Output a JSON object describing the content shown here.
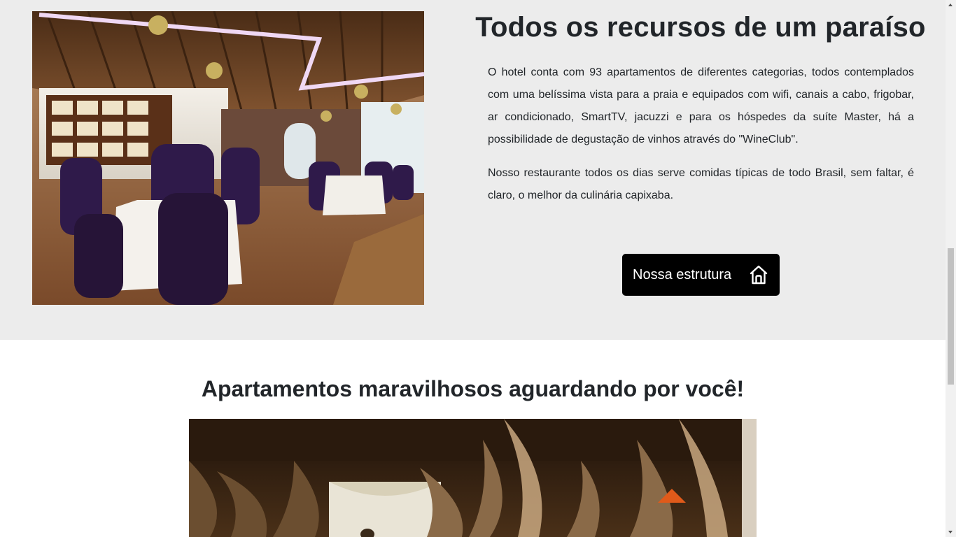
{
  "features": {
    "title": "Todos os recursos de um paraíso",
    "paragraph_1": "O hotel conta com 93 apartamentos de diferentes categorias, todos contemplados com uma belíssima vista para a praia e equipados com wifi, canais a cabo, frigobar, ar condicionado, SmartTV, jacuzzi e para os hóspedes da suíte Master, há a possibilidade de degustação de vinhos através do \"WineClub\".",
    "paragraph_2": "Nosso restaurante todos os dias serve comidas típicas de todo Brasil, sem faltar, é claro, o melhor da culinária capixaba.",
    "button_label": "Nossa estrutura",
    "button_icon": "home-icon",
    "background_color": "#ececec",
    "button_color": "#000000"
  },
  "apartments": {
    "title": "Apartamentos maravilhosos aguardando por você!"
  }
}
